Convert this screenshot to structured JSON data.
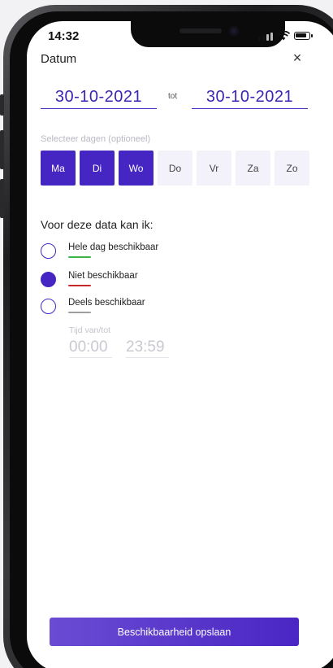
{
  "status_bar": {
    "time": "14:32"
  },
  "header": {
    "title": "Datum",
    "close_icon": "×"
  },
  "date_range": {
    "from_value": "30-10-2021",
    "separator": "tot",
    "to_value": "30-10-2021"
  },
  "day_selector": {
    "label": "Selecteer dagen (optioneel)",
    "days": [
      {
        "label": "Ma",
        "selected": true
      },
      {
        "label": "Di",
        "selected": true
      },
      {
        "label": "Wo",
        "selected": true
      },
      {
        "label": "Do",
        "selected": false
      },
      {
        "label": "Vr",
        "selected": false
      },
      {
        "label": "Za",
        "selected": false
      },
      {
        "label": "Zo",
        "selected": false
      }
    ]
  },
  "availability": {
    "heading": "Voor deze data kan ik:",
    "options": [
      {
        "label": "Hele dag beschikbaar",
        "checked": false,
        "color": "#3cb44b"
      },
      {
        "label": "Niet beschikbaar",
        "checked": true,
        "color": "#c62828"
      },
      {
        "label": "Deels beschikbaar",
        "checked": false,
        "color": "#9e9e9e"
      }
    ],
    "time_label": "Tijd van/tot",
    "time_from": "00:00",
    "time_to": "23:59"
  },
  "footer": {
    "save_label": "Beschikbaarheid opslaan"
  },
  "colors": {
    "accent": "#4626c2",
    "unselected_day": "#f3f2fb"
  }
}
